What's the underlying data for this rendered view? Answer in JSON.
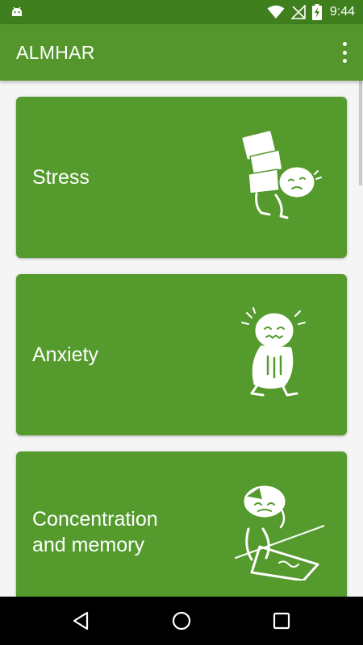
{
  "status_bar": {
    "time": "9:44",
    "icons": [
      "android-debug-icon",
      "wifi-icon",
      "no-signal-icon",
      "battery-charging-icon"
    ]
  },
  "app_bar": {
    "title": "ALMHAR",
    "overflow_icon": "more-vert-icon"
  },
  "cards": [
    {
      "title": "Stress",
      "illustration": "stressed-person-carrying-boxes"
    },
    {
      "title": "Anxiety",
      "illustration": "anxious-person-biting-nails"
    },
    {
      "title": "Concentration and memory",
      "title_line1": "Concentration",
      "title_line2": "and memory",
      "illustration": "confused-person-drawing"
    }
  ],
  "nav_bar": {
    "icons": [
      "back-icon",
      "home-icon",
      "recents-icon"
    ]
  },
  "colors": {
    "status_bar": "#3f7f1e",
    "app_bar": "#54962b",
    "card": "#559a2d",
    "background": "#f5f5f5",
    "nav_bar": "#000000"
  }
}
